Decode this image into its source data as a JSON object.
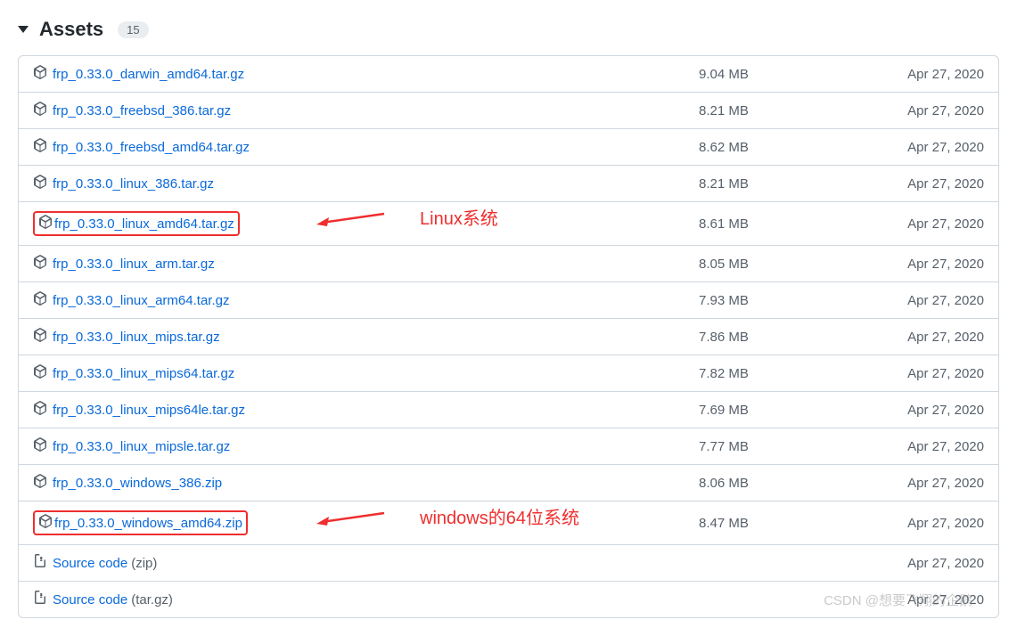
{
  "header": {
    "title": "Assets",
    "count": "15"
  },
  "assets": [
    {
      "name": "frp_0.33.0_darwin_amd64.tar.gz",
      "size": "9.04 MB",
      "date": "Apr 27, 2020",
      "type": "package"
    },
    {
      "name": "frp_0.33.0_freebsd_386.tar.gz",
      "size": "8.21 MB",
      "date": "Apr 27, 2020",
      "type": "package"
    },
    {
      "name": "frp_0.33.0_freebsd_amd64.tar.gz",
      "size": "8.62 MB",
      "date": "Apr 27, 2020",
      "type": "package"
    },
    {
      "name": "frp_0.33.0_linux_386.tar.gz",
      "size": "8.21 MB",
      "date": "Apr 27, 2020",
      "type": "package"
    },
    {
      "name": "frp_0.33.0_linux_amd64.tar.gz",
      "size": "8.61 MB",
      "date": "Apr 27, 2020",
      "type": "package",
      "highlight": true,
      "annotation": "Linux系统"
    },
    {
      "name": "frp_0.33.0_linux_arm.tar.gz",
      "size": "8.05 MB",
      "date": "Apr 27, 2020",
      "type": "package"
    },
    {
      "name": "frp_0.33.0_linux_arm64.tar.gz",
      "size": "7.93 MB",
      "date": "Apr 27, 2020",
      "type": "package"
    },
    {
      "name": "frp_0.33.0_linux_mips.tar.gz",
      "size": "7.86 MB",
      "date": "Apr 27, 2020",
      "type": "package"
    },
    {
      "name": "frp_0.33.0_linux_mips64.tar.gz",
      "size": "7.82 MB",
      "date": "Apr 27, 2020",
      "type": "package"
    },
    {
      "name": "frp_0.33.0_linux_mips64le.tar.gz",
      "size": "7.69 MB",
      "date": "Apr 27, 2020",
      "type": "package"
    },
    {
      "name": "frp_0.33.0_linux_mipsle.tar.gz",
      "size": "7.77 MB",
      "date": "Apr 27, 2020",
      "type": "package"
    },
    {
      "name": "frp_0.33.0_windows_386.zip",
      "size": "8.06 MB",
      "date": "Apr 27, 2020",
      "type": "package"
    },
    {
      "name": "frp_0.33.0_windows_amd64.zip",
      "size": "8.47 MB",
      "date": "Apr 27, 2020",
      "type": "package",
      "highlight": true,
      "annotation": "windows的64位系统"
    },
    {
      "name": "Source code",
      "suffix": "(zip)",
      "size": "",
      "date": "Apr 27, 2020",
      "type": "zip"
    },
    {
      "name": "Source code",
      "suffix": "(tar.gz)",
      "size": "",
      "date": "Apr 27, 2020",
      "type": "zip"
    }
  ],
  "watermark": "CSDN @想要飞翔的企鹅"
}
